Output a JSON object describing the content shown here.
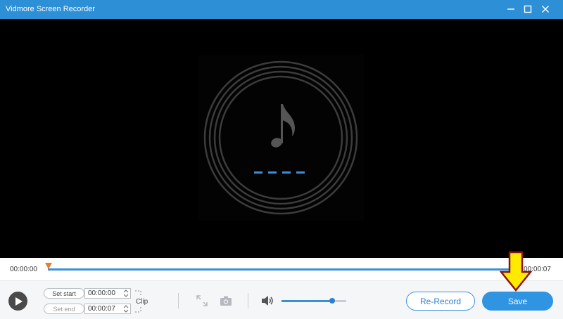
{
  "window": {
    "title": "Vidmore Screen Recorder"
  },
  "timeline": {
    "current_time": "00:00:00",
    "end_time": "00:00:07",
    "progress": 0
  },
  "clip": {
    "set_start_label": "Set start",
    "start_value": "00:00:00",
    "set_end_label": "Set end",
    "end_value": "00:00:07",
    "clip_label": "Clip"
  },
  "volume": {
    "level": 0.78
  },
  "actions": {
    "rerecord_label": "Re-Record",
    "save_label": "Save"
  },
  "colors": {
    "titlebar": "#2d8fd5",
    "accent": "#3a8fd9",
    "annotation_arrow": "#ffea00"
  }
}
